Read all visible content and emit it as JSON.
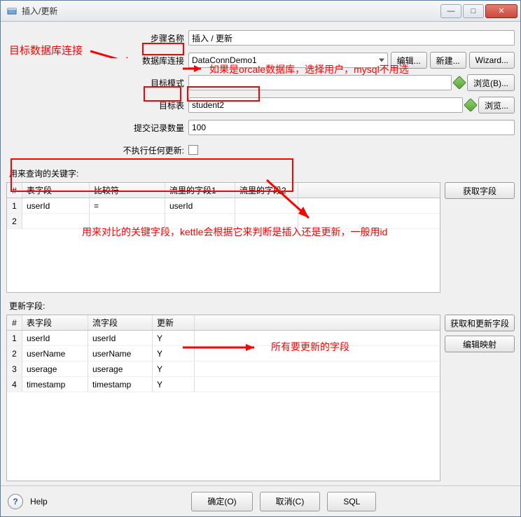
{
  "window": {
    "title": "插入/更新"
  },
  "labels": {
    "stepName": "步骤名称",
    "dbConn": "数据库连接",
    "targetSchema": "目标模式",
    "targetTable": "目标表",
    "commitSize": "提交记录数量",
    "noUpdate": "不执行任何更新:",
    "keysSection": "用来查询的关键字:",
    "updateSection": "更新字段:"
  },
  "values": {
    "stepName": "插入 / 更新",
    "dbConn": "DataConnDemo1",
    "targetSchema": "",
    "targetTable": "student2",
    "commitSize": "100"
  },
  "buttons": {
    "edit": "编辑...",
    "new": "新建...",
    "wizard": "Wizard...",
    "browseB": "浏览(B)...",
    "browse": "浏览...",
    "getFields": "获取字段",
    "getUpdateFields": "获取和更新字段",
    "editMapping": "编辑映射",
    "ok": "确定(O)",
    "cancel": "取消(C)",
    "sql": "SQL",
    "help": "Help"
  },
  "keysTable": {
    "headers": {
      "num": "#",
      "c1": "表字段",
      "c2": "比较符",
      "c3": "流里的字段1",
      "c4": "流里的字段2"
    },
    "rows": [
      {
        "num": "1",
        "c1": "userId",
        "c2": "=",
        "c3": "userId",
        "c4": ""
      },
      {
        "num": "2",
        "c1": "",
        "c2": "",
        "c3": "",
        "c4": ""
      }
    ]
  },
  "updateTable": {
    "headers": {
      "num": "#",
      "c1": "表字段",
      "c2": "流字段",
      "c3": "更新"
    },
    "rows": [
      {
        "num": "1",
        "c1": "userId",
        "c2": "userId",
        "c3": "Y"
      },
      {
        "num": "2",
        "c1": "userName",
        "c2": "userName",
        "c3": "Y"
      },
      {
        "num": "3",
        "c1": "userage",
        "c2": "userage",
        "c3": "Y"
      },
      {
        "num": "4",
        "c1": "timestamp",
        "c2": "timestamp",
        "c3": "Y"
      }
    ]
  },
  "annotations": {
    "dbConnLabel": "目标数据库连接",
    "schemaNote": "如果是orcale数据库，选择用户，mysql不用选",
    "keysNote": "用来对比的关键字段，kettle会根据它来判断是插入还是更新，一般用id",
    "updateNote": "所有要更新的字段"
  }
}
